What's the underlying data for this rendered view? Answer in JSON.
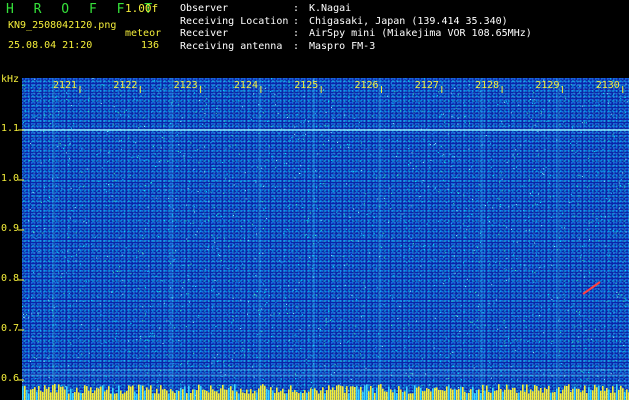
{
  "header": {
    "brand": "H R O F F T",
    "version": "1.00f",
    "filename": "KN9_2508042120.png",
    "meteor_label": "meteor",
    "datetime": "25.08.04 21:20",
    "meteor_count": "136",
    "info": [
      {
        "key": "Observer",
        "sep": ":",
        "value": "K.Nagai"
      },
      {
        "key": "Receiving Location",
        "sep": ":",
        "value": "Chigasaki, Japan (139.414 35.340)"
      },
      {
        "key": "Receiver",
        "sep": ":",
        "value": "AirSpy mini (Miakejima VOR 108.65MHz)"
      },
      {
        "key": "Receiving antenna",
        "sep": ":",
        "value": "Maspro FM-3"
      }
    ]
  },
  "chart_data": {
    "type": "heatmap",
    "ylabel": "kHz",
    "x_ticks": [
      "2121",
      "2122",
      "2123",
      "2124",
      "2125",
      "2126",
      "2127",
      "2128",
      "2129",
      "2130"
    ],
    "y_ticks": [
      "1.1",
      "1.0",
      "0.9",
      "0.8",
      "0.7",
      "0.6"
    ],
    "y_range": [
      0.58,
      1.2
    ],
    "carrier_lines_khz": [
      1.1,
      0.62,
      0.61
    ],
    "colors": {
      "background": "#0b25a8",
      "carrier": "#9df5ff",
      "meteor": "#ff4040",
      "tick_text": "#f4ee3a"
    }
  }
}
